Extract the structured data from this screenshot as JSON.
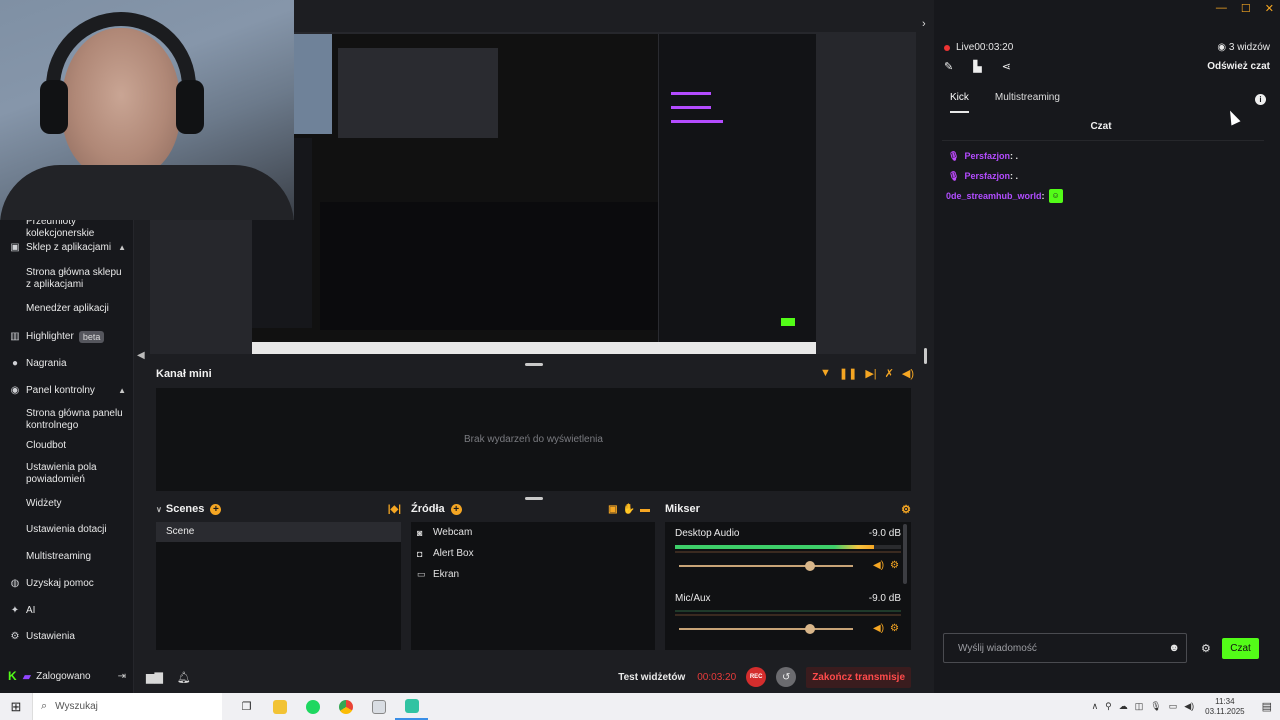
{
  "sidebar": {
    "items": [
      {
        "label": "Przedmioty kolekcjonerskie",
        "icon": "",
        "sub": true
      },
      {
        "label": "Sklep z aplikacjami",
        "icon": "store-icon",
        "chev": "▲"
      },
      {
        "label": "Strona główna sklepu z aplikacjami",
        "sub": true
      },
      {
        "label": "Menedżer aplikacji",
        "sub": true
      },
      {
        "label": "Highlighter",
        "icon": "highlighter-icon",
        "badge": "beta"
      },
      {
        "label": "Nagrania",
        "icon": "recordings-icon"
      },
      {
        "label": "Panel kontrolny",
        "icon": "dashboard-icon",
        "chev": "▲"
      },
      {
        "label": "Strona główna panelu kontrolnego",
        "sub": true
      },
      {
        "label": "Cloudbot",
        "sub": true
      },
      {
        "label": "Ustawienia pola powiadomień",
        "sub": true
      },
      {
        "label": "Widżety",
        "sub": true
      },
      {
        "label": "Ustawienia dotacji",
        "sub": true
      },
      {
        "label": "Multistreaming",
        "sub": true
      },
      {
        "label": "Uzyskaj pomoc",
        "icon": "help-icon"
      },
      {
        "label": "AI",
        "icon": "ai-icon"
      },
      {
        "label": "Ustawienia",
        "icon": "settings-icon"
      }
    ],
    "bottom": {
      "label": "Zalogowano"
    }
  },
  "center": {
    "events_title": "Kanał mini",
    "events_empty": "Brak wydarzeń do wyświetlenia",
    "scenes_title": "Scenes",
    "scenes": [
      "Scene"
    ],
    "sources_title": "Źródła",
    "sources": [
      {
        "label": "Webcam",
        "icon": "webcam-icon"
      },
      {
        "label": "Alert Box",
        "icon": "alertbox-icon"
      },
      {
        "label": "Ekran",
        "icon": "display-icon"
      }
    ],
    "mixer_title": "Mikser",
    "mixer": [
      {
        "name": "Desktop Audio",
        "db": "-9.0 dB",
        "level": 0.88,
        "volume": 0.75
      },
      {
        "name": "Mic/Aux",
        "db": "-9.0 dB",
        "level": 0.0,
        "volume": 0.75
      }
    ],
    "bottom": {
      "test_widgets": "Test widżetów",
      "timer": "00:03:20",
      "rec": "REC",
      "end_stream": "Zakończ transmisje"
    }
  },
  "right": {
    "live_label": "Live",
    "live_time": "00:03:20",
    "viewers": "3 widzów",
    "refresh_chat": "Odśwież czat",
    "tabs": [
      "Kick",
      "Multistreaming"
    ],
    "chat_title": "Czat",
    "messages": [
      {
        "user": "Persfazjon",
        "text": ": ."
      },
      {
        "user": "Persfazjon",
        "text": ": ."
      },
      {
        "user": "0de_streamhub_world",
        "text": ":"
      }
    ],
    "input_placeholder": "Wyślij wiadomość",
    "send_label": "Czat"
  },
  "taskbar": {
    "search_placeholder": "Wyszukaj",
    "time": "11:34",
    "date": "03.11.2025"
  },
  "colors": {
    "accent": "#f5a623",
    "kick_green": "#53fc18",
    "live_red": "#e63b3b",
    "chat_user": "#b44cff"
  }
}
